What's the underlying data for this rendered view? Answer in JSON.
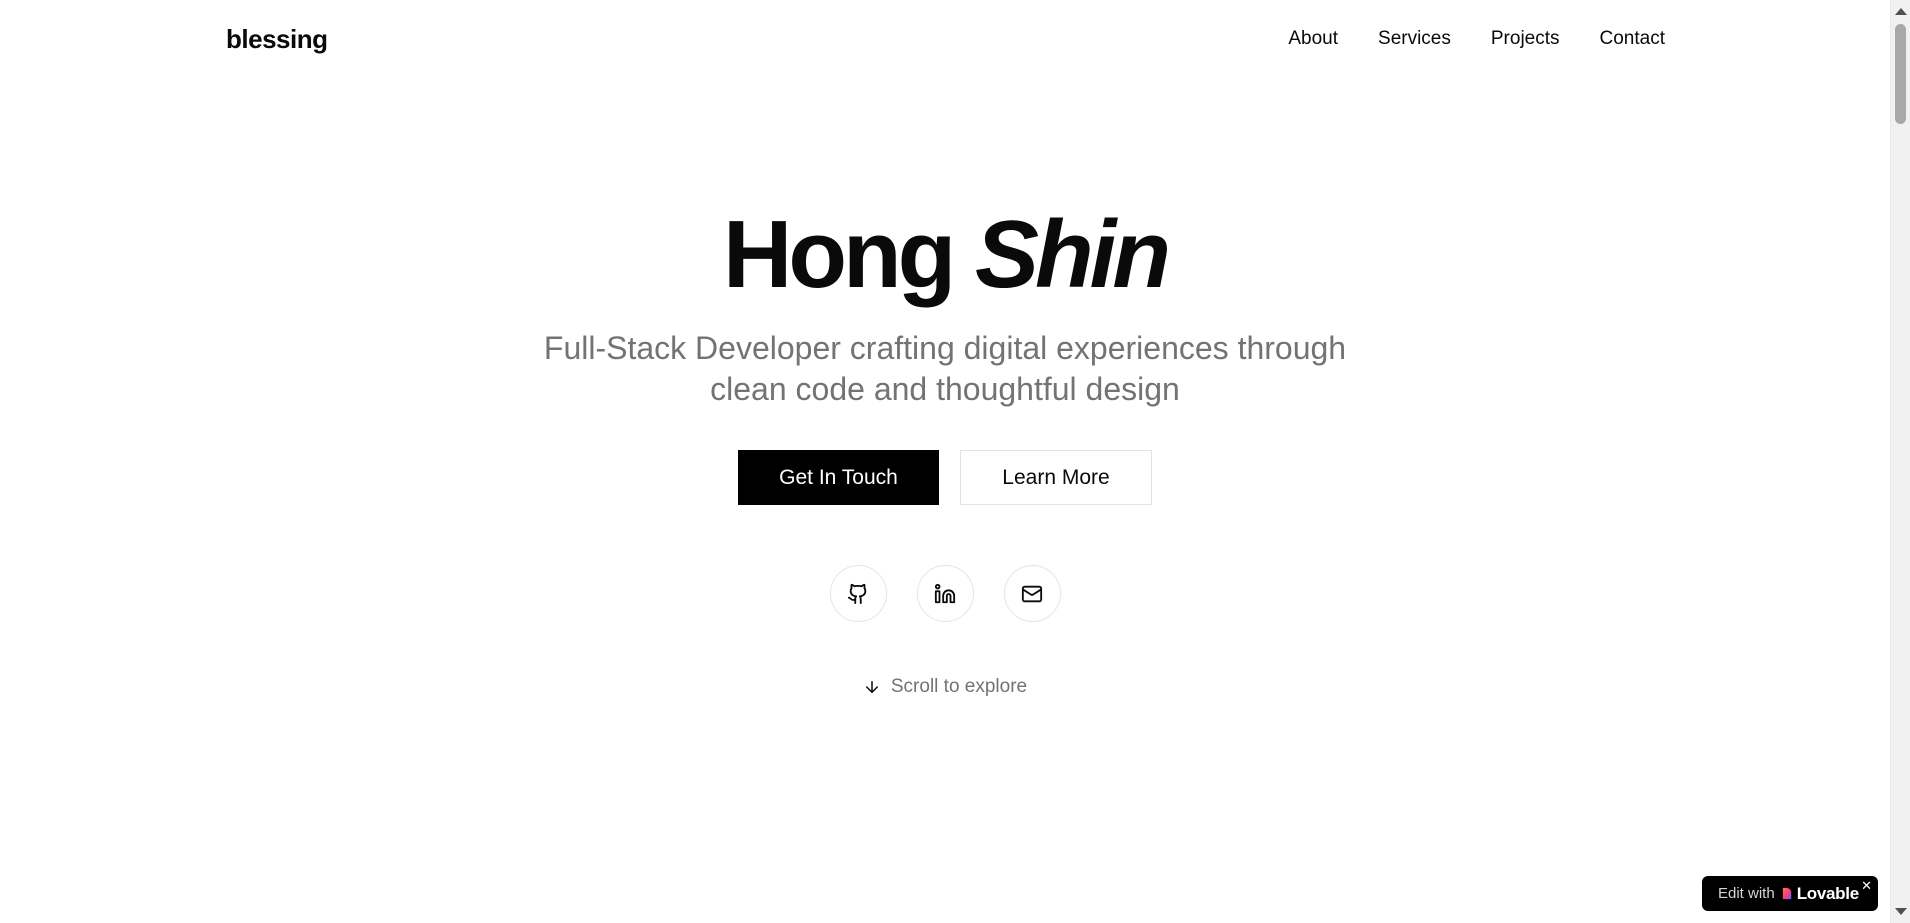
{
  "header": {
    "logo": "blessing",
    "nav": [
      {
        "label": "About"
      },
      {
        "label": "Services"
      },
      {
        "label": "Projects"
      },
      {
        "label": "Contact"
      }
    ]
  },
  "hero": {
    "name_first": "Hong",
    "name_last": "Shin",
    "subtitle": "Full-Stack Developer crafting digital experiences through clean code and thoughtful design",
    "primary_button": "Get In Touch",
    "secondary_button": "Learn More",
    "social": [
      {
        "icon": "github-icon"
      },
      {
        "icon": "linkedin-icon"
      },
      {
        "icon": "mail-icon"
      }
    ],
    "scroll_hint": "Scroll to explore"
  },
  "badge": {
    "prefix": "Edit with",
    "brand": "Lovable",
    "close": "✕"
  },
  "colors": {
    "background": "#ffffff",
    "text": "#0a0a0a",
    "muted": "#737373",
    "primary_button": "#000000",
    "border": "#e5e5e5"
  }
}
